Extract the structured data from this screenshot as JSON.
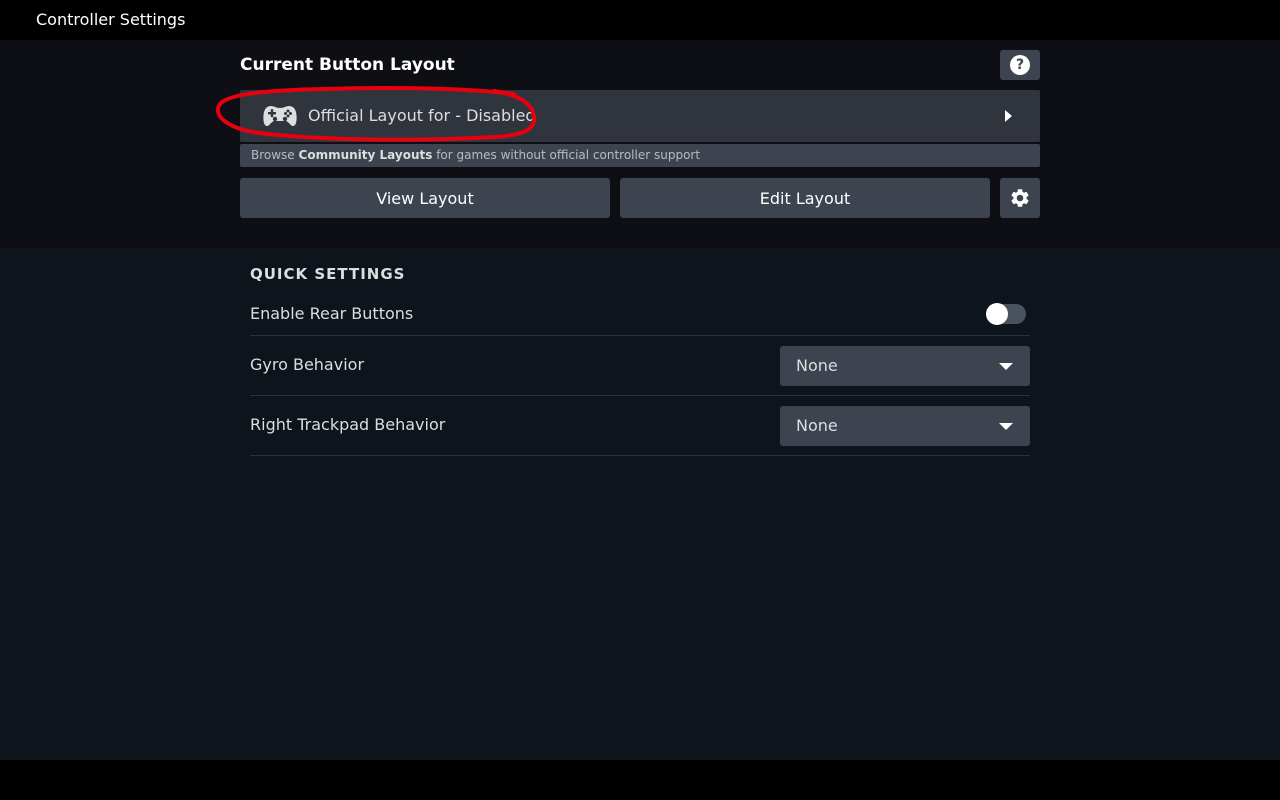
{
  "app": {
    "title": "Controller Settings"
  },
  "layout_section": {
    "title": "Current Button Layout",
    "help_icon": "question-circle-icon",
    "current_layout": {
      "icon": "gamepad-icon",
      "name": "Official Layout for - Disabled",
      "chevron_icon": "chevron-right-icon"
    },
    "community_banner": {
      "prefix": "Browse ",
      "highlight": "Community Layouts",
      "suffix": " for games without official controller support"
    },
    "buttons": {
      "view_label": "View Layout",
      "edit_label": "Edit Layout",
      "settings_icon": "gear-icon"
    }
  },
  "quick_settings": {
    "title": "QUICK SETTINGS",
    "rear_buttons": {
      "label": "Enable Rear Buttons",
      "enabled": false
    },
    "gyro": {
      "label": "Gyro Behavior",
      "value": "None"
    },
    "trackpad": {
      "label": "Right Trackpad Behavior",
      "value": "None"
    }
  },
  "colors": {
    "annotation": "#e8000e",
    "button_bg": "#3d4450",
    "layout_row_bg": "#30343c",
    "section_bg": "#0e141b"
  }
}
